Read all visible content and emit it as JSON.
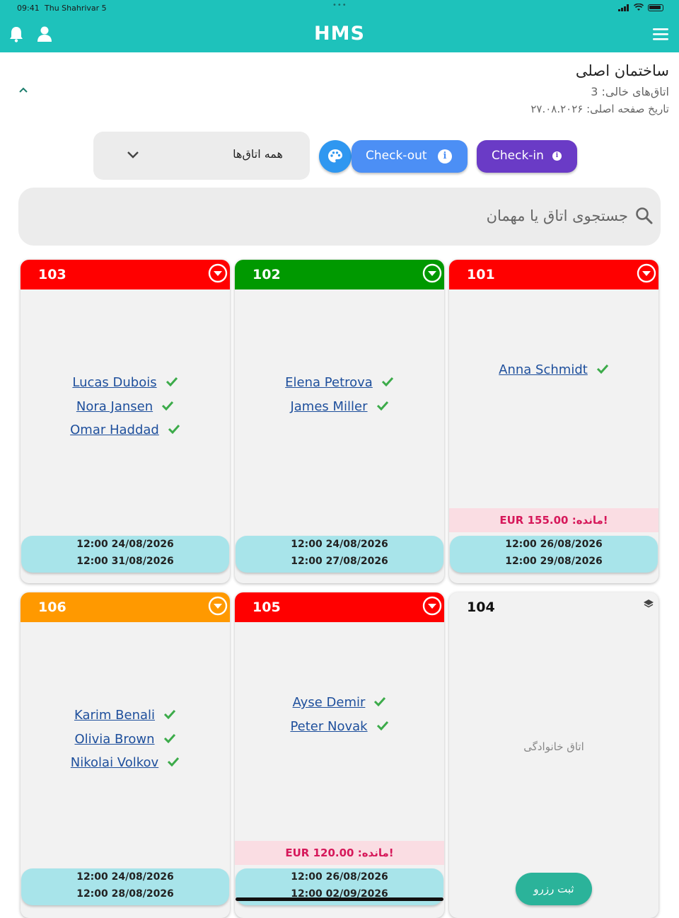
{
  "status_bar": {
    "time": "09:41",
    "date": "Thu Shahrivar 5"
  },
  "app": {
    "title": "HMS"
  },
  "building": {
    "name": "ساختمان اصلی",
    "empty_rooms": "اتاق‌های خالی: 3",
    "main_date": "تاریخ صفحه اصلی: ۲۷.۰۸.۲۰۲۶"
  },
  "filter": {
    "selected": "همه اتاق‌ها"
  },
  "actions": {
    "checkout_label": "Check-out",
    "checkin_label": "Check-in"
  },
  "search": {
    "placeholder": "جستجوی اتاق یا مهمان"
  },
  "colors": {
    "teal": "#1ec2bb",
    "red": "#ff0000",
    "green": "#009900",
    "orange": "#ff9900",
    "checkout": "#4c8ff5",
    "checkin": "#6a3bc6"
  },
  "rooms": [
    {
      "number": "103",
      "status_color": "#ff0000",
      "guests": [
        "Lucas Dubois",
        "Nora Jansen",
        "Omar Haddad"
      ],
      "checkin": "12:00 24/08/2026",
      "checkout": "12:00 31/08/2026"
    },
    {
      "number": "102",
      "status_color": "#009900",
      "guests": [
        "Elena Petrova",
        "James Miller"
      ],
      "checkin": "12:00 24/08/2026",
      "checkout": "12:00 27/08/2026"
    },
    {
      "number": "101",
      "status_color": "#ff0000",
      "guests": [
        "Anna Schmidt"
      ],
      "balance": "!مانده: EUR 155.00",
      "checkin": "12:00 26/08/2026",
      "checkout": "12:00 29/08/2026"
    },
    {
      "number": "106",
      "status_color": "#ff9900",
      "guests": [
        "Karim Benali",
        "Olivia Brown",
        "Nikolai Volkov"
      ],
      "checkin": "12:00 24/08/2026",
      "checkout": "12:00 28/08/2026"
    },
    {
      "number": "105",
      "status_color": "#ff0000",
      "guests": [
        "Ayse Demir",
        "Peter Novak"
      ],
      "balance": "!مانده: EUR 120.00",
      "checkin": "12:00 26/08/2026",
      "checkout": "12:00 02/09/2026"
    },
    {
      "number": "104",
      "room_type": "اتاق خانوادگی",
      "reserve_label": "ثبت رزرو"
    }
  ]
}
